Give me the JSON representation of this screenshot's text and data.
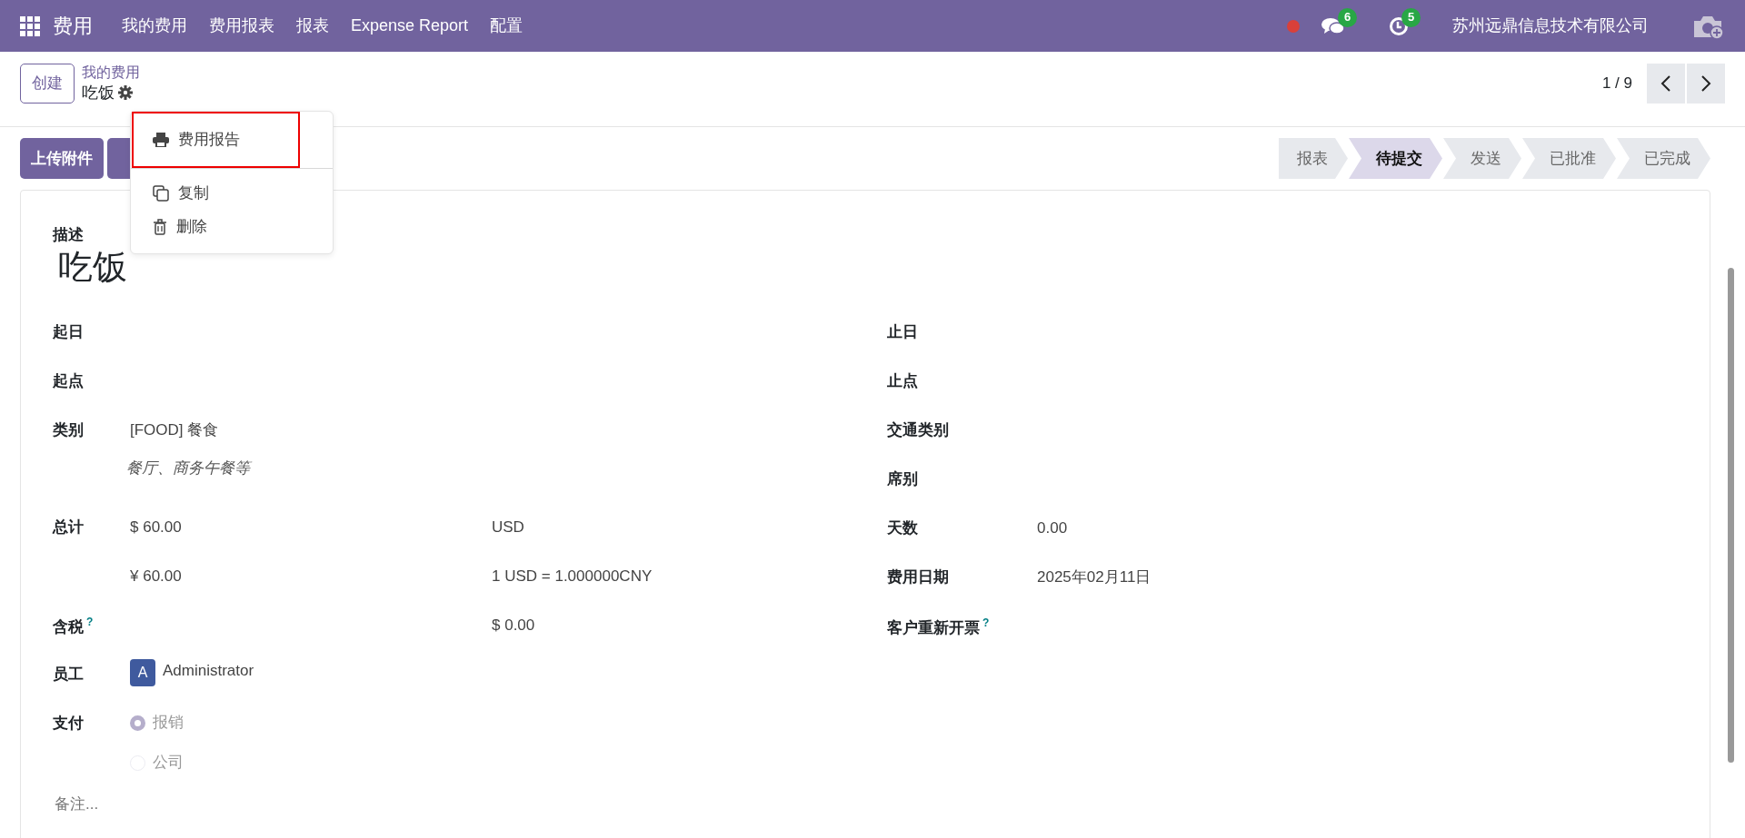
{
  "navbar": {
    "app_name": "费用",
    "menu": [
      "我的费用",
      "费用报表",
      "报表",
      "Expense Report",
      "配置"
    ],
    "messages_count": "6",
    "activities_count": "5",
    "company": "苏州远鼎信息技术有限公司"
  },
  "control_panel": {
    "create_button": "创建",
    "breadcrumb": "我的费用",
    "record_name": "吃饭",
    "pager": "1 / 9"
  },
  "action_menu": {
    "items": [
      {
        "kind": "print",
        "label": "费用报告",
        "highlighted": true,
        "separator_before": false
      },
      {
        "kind": "copy",
        "label": "复制",
        "highlighted": false,
        "separator_before": true
      },
      {
        "kind": "delete",
        "label": "删除",
        "highlighted": false,
        "separator_before": false
      }
    ]
  },
  "buttons": [
    "上传附件"
  ],
  "status_steps": [
    {
      "label": "报表",
      "selected": false
    },
    {
      "label": "待提交",
      "selected": true
    },
    {
      "label": "发送",
      "selected": false
    },
    {
      "label": "已批准",
      "selected": false
    },
    {
      "label": "已完成",
      "selected": false
    }
  ],
  "form": {
    "description_label": "描述",
    "title": "吃饭",
    "left_fields": [
      {
        "kind": "text",
        "label": "起日"
      },
      {
        "kind": "text",
        "label": "起点"
      },
      {
        "kind": "text",
        "label": "类别",
        "value": "[FOOD] 餐食",
        "note": "餐厅、商务午餐等"
      },
      {
        "kind": "text",
        "label": "总计",
        "value": "$ 60.00",
        "value_2": "USD"
      },
      {
        "kind": "text",
        "value": "¥ 60.00",
        "value_2": "1 USD = 1.000000CNY"
      },
      {
        "kind": "text",
        "label": "含税",
        "help": "?",
        "value_2": "$ 0.00"
      },
      {
        "kind": "avatar",
        "label": "员工",
        "avatar": "A",
        "value": "Administrator"
      },
      {
        "kind": "radio",
        "label": "支付",
        "options": [
          {
            "label": "报销",
            "selected": true
          },
          {
            "label": "公司",
            "selected": false
          }
        ]
      }
    ],
    "right_fields": [
      {
        "kind": "text",
        "label": "止日"
      },
      {
        "kind": "text",
        "label": "止点"
      },
      {
        "kind": "text",
        "label": "交通类别"
      },
      {
        "kind": "text",
        "label": "席别"
      },
      {
        "kind": "text",
        "label": "天数",
        "value": "0.00"
      },
      {
        "kind": "text",
        "label": "费用日期",
        "value": "2025年02月11日"
      },
      {
        "kind": "text",
        "label": "客户重新开票",
        "help": "?"
      }
    ],
    "notes_placeholder": "备注..."
  }
}
